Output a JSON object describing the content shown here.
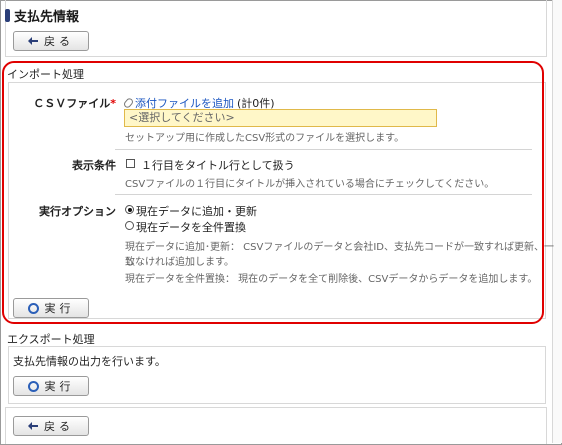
{
  "page": {
    "title": "支払先情報"
  },
  "nav": {
    "back_label": "戻る"
  },
  "import": {
    "header": "インポート処理",
    "csv": {
      "label": "ＣＳＶファイル",
      "required_mark": "*",
      "attach_link": "添付ファイルを追加",
      "attach_count": "(計0件)",
      "select_placeholder": "<選択してください>",
      "help": "セットアップ用に作成したCSV形式のファイルを選択します。"
    },
    "display": {
      "label": "表示条件",
      "checkbox_label": "１行目をタイトル行として扱う",
      "checkbox_checked": false,
      "help": "CSVファイルの１行目にタイトルが挿入されている場合にチェックしてください。"
    },
    "exec_option": {
      "label": "実行オプション",
      "options": [
        "現在データに追加・更新",
        "現在データを全件置換"
      ],
      "selected": "現在データに追加・更新",
      "help_lines": [
        "現在データに追加･更新： CSVファイルのデータと会社ID、支払先コードが一致すれば更新、一致",
        "しなければ追加します。",
        "現在データを全件置換： 現在のデータを全て削除後、CSVデータからデータを追加します。"
      ]
    },
    "execute_label": "実行"
  },
  "export": {
    "header": "エクスポート処理",
    "description": "支払先情報の出力を行います。",
    "execute_label": "実行"
  },
  "icons": {
    "back": "arrow-left-icon",
    "execute": "circle-icon",
    "attach": "paperclip-icon"
  },
  "colors": {
    "required": "#e00000",
    "link": "#1a55c0",
    "highlight_border": "#e00000",
    "select_bg": "#fff7c8"
  }
}
